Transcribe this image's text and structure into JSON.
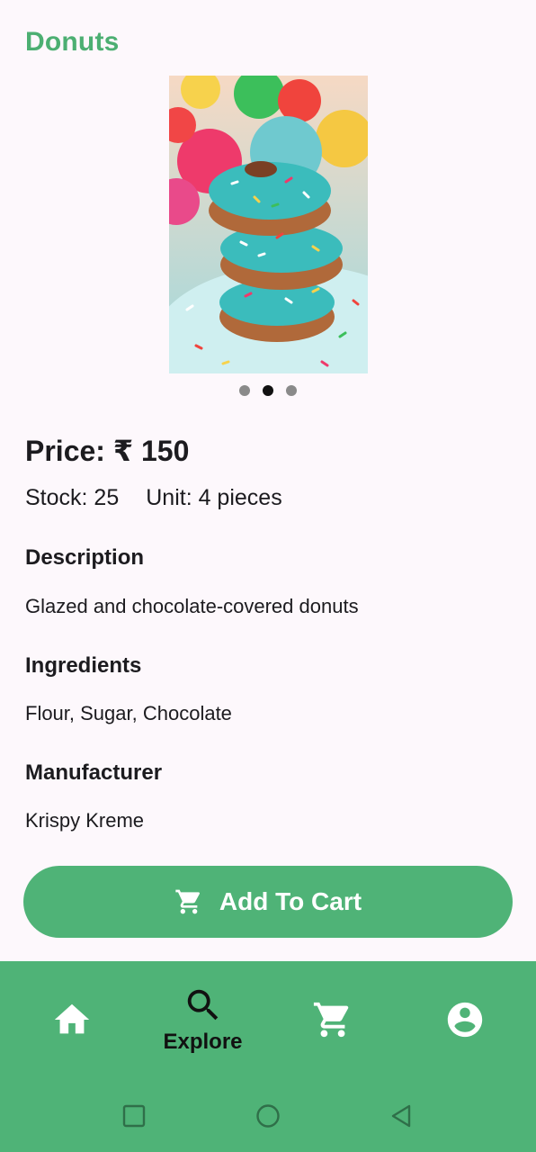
{
  "product": {
    "title": "Donuts",
    "price": "Price: ₹ 150",
    "stock": "Stock: 25",
    "unit": "Unit: 4 pieces"
  },
  "carousel": {
    "count": 3,
    "active_index": 1
  },
  "sections": {
    "description": {
      "heading": "Description",
      "text": "Glazed and chocolate-covered donuts"
    },
    "ingredients": {
      "heading": "Ingredients",
      "text": "Flour, Sugar, Chocolate"
    },
    "manufacturer": {
      "heading": "Manufacturer",
      "text": "Krispy Kreme"
    }
  },
  "actions": {
    "add_to_cart": "Add To Cart"
  },
  "bottom_nav": {
    "active": "explore",
    "items": [
      {
        "id": "home",
        "icon": "home-icon",
        "label": ""
      },
      {
        "id": "explore",
        "icon": "search-icon",
        "label": "Explore"
      },
      {
        "id": "cart",
        "icon": "cart-icon",
        "label": ""
      },
      {
        "id": "profile",
        "icon": "account-icon",
        "label": ""
      }
    ]
  },
  "colors": {
    "accent": "#4fb377",
    "title": "#4caf72",
    "background": "#fdf8fc"
  }
}
